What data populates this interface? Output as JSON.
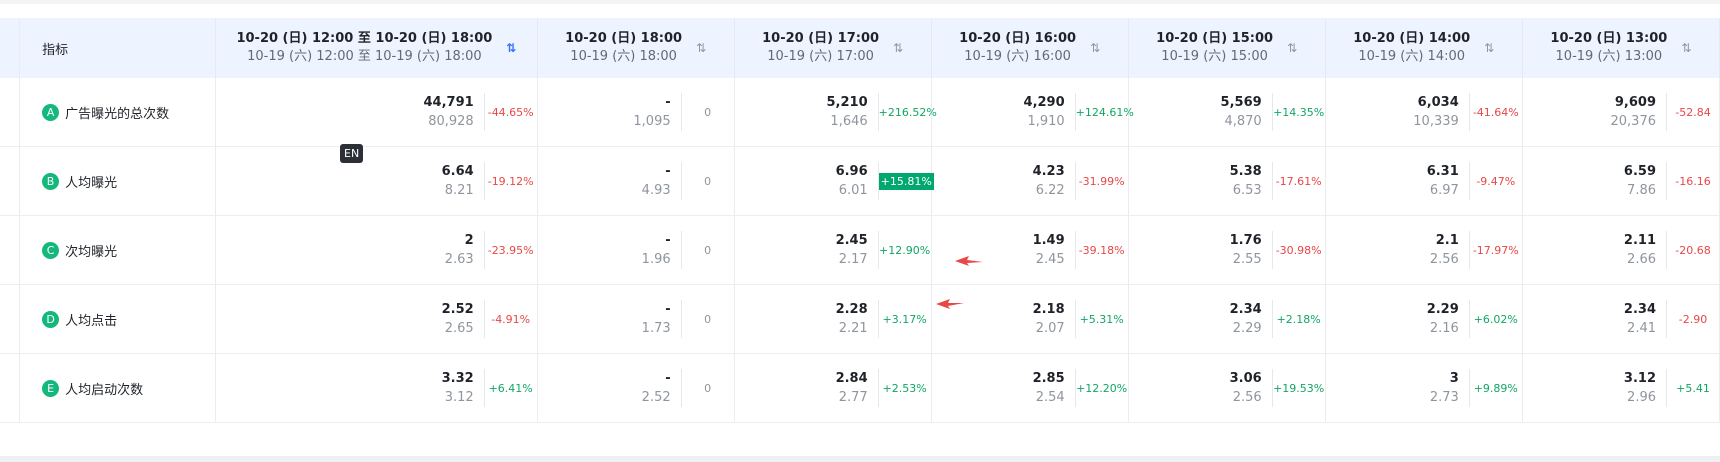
{
  "header": {
    "metric_label": "指标",
    "columns": [
      {
        "l1": "10-20 (日) 12:00 至 10-20 (日) 18:00",
        "l2": "10-19 (六) 12:00 至 10-19 (六) 18:00",
        "sort_icon": "sort-active-icon"
      },
      {
        "l1": "10-20 (日) 18:00",
        "l2": "10-19 (六) 18:00",
        "sort_icon": "sort-icon"
      },
      {
        "l1": "10-20 (日) 17:00",
        "l2": "10-19 (六) 17:00",
        "sort_icon": "sort-icon"
      },
      {
        "l1": "10-20 (日) 16:00",
        "l2": "10-19 (六) 16:00",
        "sort_icon": "sort-icon"
      },
      {
        "l1": "10-20 (日) 15:00",
        "l2": "10-19 (六) 15:00",
        "sort_icon": "sort-icon"
      },
      {
        "l1": "10-20 (日) 14:00",
        "l2": "10-19 (六) 14:00",
        "sort_icon": "sort-icon"
      },
      {
        "l1": "10-20 (日) 13:00",
        "l2": "10-19 (六) 13:00",
        "sort_icon": "sort-icon"
      }
    ]
  },
  "rows": [
    {
      "letter": "A",
      "name": "广告曝光的总次数",
      "cells": [
        {
          "v1": "44,791",
          "v2": "80,928",
          "pct": "-44.65%",
          "type": "neg"
        },
        {
          "v1": "-",
          "v2": "1,095",
          "pct": "0",
          "type": "zero"
        },
        {
          "v1": "5,210",
          "v2": "1,646",
          "pct": "+216.52%",
          "type": "pos"
        },
        {
          "v1": "4,290",
          "v2": "1,910",
          "pct": "+124.61%",
          "type": "pos"
        },
        {
          "v1": "5,569",
          "v2": "4,870",
          "pct": "+14.35%",
          "type": "pos"
        },
        {
          "v1": "6,034",
          "v2": "10,339",
          "pct": "-41.64%",
          "type": "neg"
        },
        {
          "v1": "9,609",
          "v2": "20,376",
          "pct": "-52.84",
          "type": "neg"
        }
      ]
    },
    {
      "letter": "B",
      "name": "人均曝光",
      "cells": [
        {
          "v1": "6.64",
          "v2": "8.21",
          "pct": "-19.12%",
          "type": "neg"
        },
        {
          "v1": "-",
          "v2": "4.93",
          "pct": "0",
          "type": "zero"
        },
        {
          "v1": "6.96",
          "v2": "6.01",
          "pct": "+15.81%",
          "type": "hl"
        },
        {
          "v1": "4.23",
          "v2": "6.22",
          "pct": "-31.99%",
          "type": "neg"
        },
        {
          "v1": "5.38",
          "v2": "6.53",
          "pct": "-17.61%",
          "type": "neg"
        },
        {
          "v1": "6.31",
          "v2": "6.97",
          "pct": "-9.47%",
          "type": "neg"
        },
        {
          "v1": "6.59",
          "v2": "7.86",
          "pct": "-16.16",
          "type": "neg"
        }
      ]
    },
    {
      "letter": "C",
      "name": "次均曝光",
      "cells": [
        {
          "v1": "2",
          "v2": "2.63",
          "pct": "-23.95%",
          "type": "neg"
        },
        {
          "v1": "-",
          "v2": "1.96",
          "pct": "0",
          "type": "zero"
        },
        {
          "v1": "2.45",
          "v2": "2.17",
          "pct": "+12.90%",
          "type": "pos"
        },
        {
          "v1": "1.49",
          "v2": "2.45",
          "pct": "-39.18%",
          "type": "neg"
        },
        {
          "v1": "1.76",
          "v2": "2.55",
          "pct": "-30.98%",
          "type": "neg"
        },
        {
          "v1": "2.1",
          "v2": "2.56",
          "pct": "-17.97%",
          "type": "neg"
        },
        {
          "v1": "2.11",
          "v2": "2.66",
          "pct": "-20.68",
          "type": "neg"
        }
      ]
    },
    {
      "letter": "D",
      "name": "人均点击",
      "cells": [
        {
          "v1": "2.52",
          "v2": "2.65",
          "pct": "-4.91%",
          "type": "neg"
        },
        {
          "v1": "-",
          "v2": "1.73",
          "pct": "0",
          "type": "zero"
        },
        {
          "v1": "2.28",
          "v2": "2.21",
          "pct": "+3.17%",
          "type": "pos"
        },
        {
          "v1": "2.18",
          "v2": "2.07",
          "pct": "+5.31%",
          "type": "pos"
        },
        {
          "v1": "2.34",
          "v2": "2.29",
          "pct": "+2.18%",
          "type": "pos"
        },
        {
          "v1": "2.29",
          "v2": "2.16",
          "pct": "+6.02%",
          "type": "pos"
        },
        {
          "v1": "2.34",
          "v2": "2.41",
          "pct": "-2.90",
          "type": "neg"
        }
      ]
    },
    {
      "letter": "E",
      "name": "人均启动次数",
      "cells": [
        {
          "v1": "3.32",
          "v2": "3.12",
          "pct": "+6.41%",
          "type": "pos"
        },
        {
          "v1": "-",
          "v2": "2.52",
          "pct": "0",
          "type": "zero"
        },
        {
          "v1": "2.84",
          "v2": "2.77",
          "pct": "+2.53%",
          "type": "pos"
        },
        {
          "v1": "2.85",
          "v2": "2.54",
          "pct": "+12.20%",
          "type": "pos"
        },
        {
          "v1": "3.06",
          "v2": "2.56",
          "pct": "+19.53%",
          "type": "pos"
        },
        {
          "v1": "3",
          "v2": "2.73",
          "pct": "+9.89%",
          "type": "pos"
        },
        {
          "v1": "3.12",
          "v2": "2.96",
          "pct": "+5.41",
          "type": "pos"
        }
      ]
    }
  ],
  "tooltip_tag": "EN",
  "colors": {
    "positive": "#12a665",
    "negative": "#e84747",
    "highlight": "#00a870",
    "accent": "#3370ff",
    "arrow": "#e84747"
  }
}
